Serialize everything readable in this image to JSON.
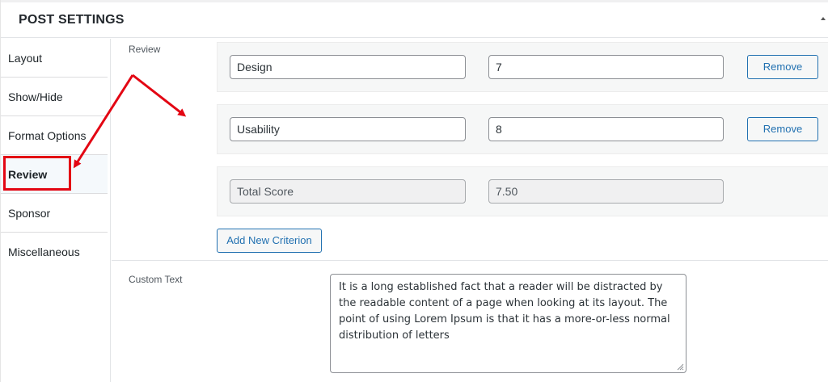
{
  "header": {
    "title": "POST SETTINGS"
  },
  "sidebar": {
    "items": [
      {
        "label": "Layout"
      },
      {
        "label": "Show/Hide"
      },
      {
        "label": "Format Options"
      },
      {
        "label": "Review",
        "active": true
      },
      {
        "label": "Sponsor"
      },
      {
        "label": "Miscellaneous"
      }
    ]
  },
  "review": {
    "label": "Review",
    "criteria": [
      {
        "name": "Design",
        "score": "7",
        "remove_label": "Remove"
      },
      {
        "name": "Usability",
        "score": "8",
        "remove_label": "Remove"
      }
    ],
    "total": {
      "name": "Total Score",
      "score": "7.50"
    },
    "add_label": "Add New Criterion"
  },
  "custom_text": {
    "label": "Custom Text",
    "value": "It is a long established fact that a reader will be distracted by the readable content of a page when looking at its layout. The point of using Lorem Ipsum is that it has a more-or-less normal distribution of letters"
  },
  "colors": {
    "annotation_red": "#e30613",
    "button_blue": "#2271b1"
  }
}
